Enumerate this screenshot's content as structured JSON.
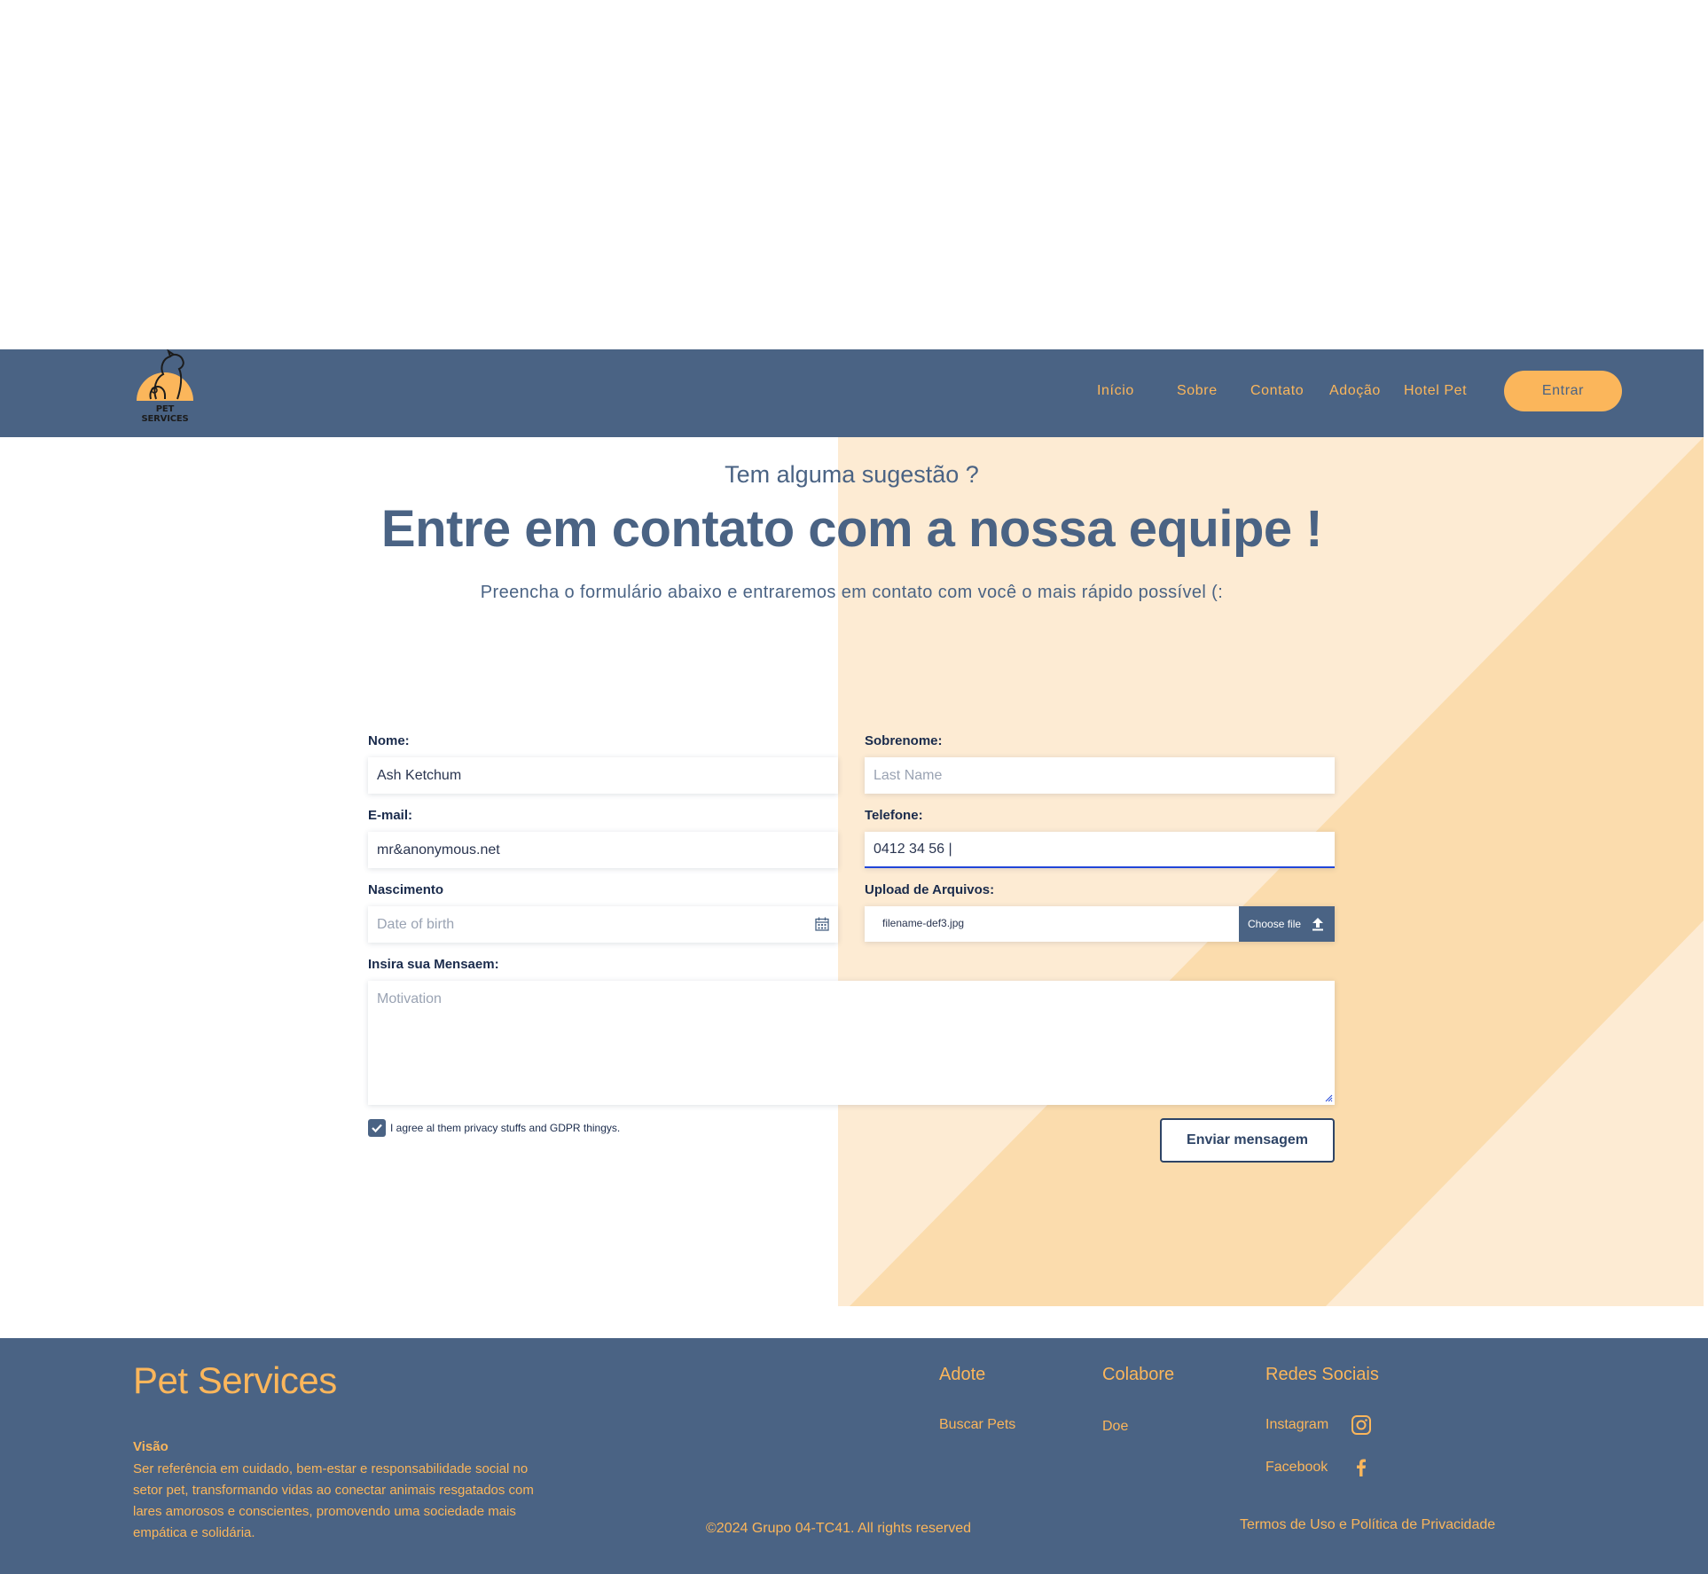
{
  "colors": {
    "navy": "#4a6384",
    "accent_orange": "#fbb65b",
    "light_peach": "#fdebd3",
    "peach": "#fbdcad"
  },
  "header": {
    "logo_text": "PET SERVICES",
    "nav": [
      "Início",
      "Sobre",
      "Contato",
      "Adoção",
      "Hotel Pet"
    ],
    "login_label": "Entrar"
  },
  "hero": {
    "kicker": "Tem alguma sugestão ?",
    "title": "Entre em contato com a nossa equipe !",
    "subtitle": "Preencha o formulário abaixo e entraremos em contato com você o mais rápido possível (:"
  },
  "form": {
    "first_name": {
      "label": "Nome:",
      "value": "Ash Ketchum",
      "placeholder": ""
    },
    "last_name": {
      "label": "Sobrenome:",
      "value": "",
      "placeholder": "Last Name"
    },
    "email": {
      "label": "E-mail:",
      "value": "mr&anonymous.net"
    },
    "phone": {
      "label": "Telefone:",
      "value": "0412 34 56 |"
    },
    "birth": {
      "label": "Nascimento",
      "placeholder": "Date of birth",
      "icon": "calendar-icon"
    },
    "upload": {
      "label": "Upload de Arquivos:",
      "filename": "filename-def3.jpg",
      "button_label": "Choose file",
      "icon": "upload-icon"
    },
    "message": {
      "label": "Insira sua Mensaem:",
      "placeholder": "Motivation"
    },
    "consent": {
      "label": "I agree al them privacy stuffs and GDPR thingys.",
      "checked": true
    },
    "submit_label": "Enviar mensagem"
  },
  "footer": {
    "brand": "Pet Services",
    "vision_title": "Visão",
    "vision_text": "Ser referência em cuidado, bem-estar e responsabilidade social no setor pet, transformando vidas ao conectar animais resgatados com lares amorosos e conscientes, promovendo uma sociedade mais empática e solidária.",
    "columns": [
      {
        "title": "Adote",
        "links": [
          "Buscar Pets"
        ]
      },
      {
        "title": "Colabore",
        "links": [
          "Doe"
        ]
      },
      {
        "title": "Redes Sociais",
        "links": [
          "Instagram",
          "Facebook"
        ]
      }
    ],
    "social_icons": [
      "instagram-icon",
      "facebook-icon"
    ],
    "copyright": "©2024 Grupo 04-TC41. All rights reserved",
    "terms": "Termos de Uso e Política de Privacidade"
  }
}
